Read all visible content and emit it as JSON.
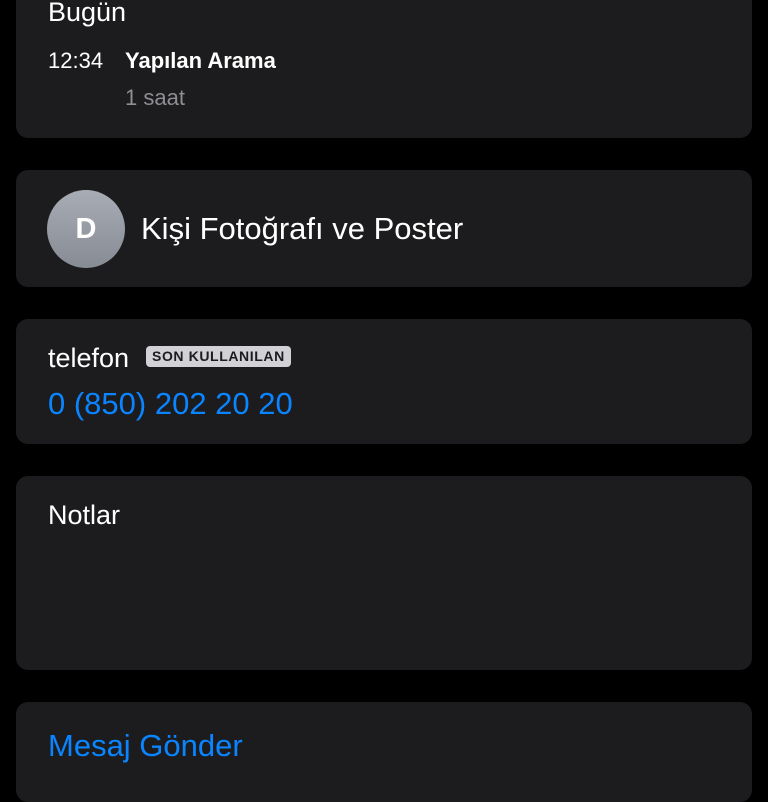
{
  "recents": {
    "day_header": "Bugün",
    "calls": [
      {
        "time": "12:34",
        "type": "Yapılan Arama",
        "duration": "1 saat"
      }
    ]
  },
  "contact_photo": {
    "avatar_initial": "D",
    "label": "Kişi Fotoğrafı ve Poster"
  },
  "phone": {
    "label": "telefon",
    "badge": "SON KULLANILAN",
    "number": "0 (850) 202 20 20"
  },
  "notes": {
    "label": "Notlar"
  },
  "actions": {
    "send_message": "Mesaj Gönder"
  },
  "colors": {
    "background": "#000000",
    "card": "#1c1c1e",
    "accent": "#0a84ff",
    "secondary_text": "#8e8e93"
  }
}
